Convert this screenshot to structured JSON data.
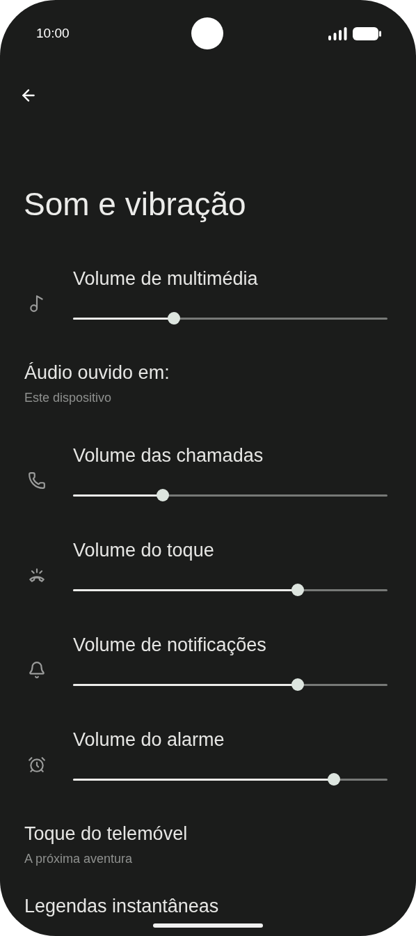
{
  "status_bar": {
    "time": "10:00"
  },
  "title": "Som e vibração",
  "items": [
    {
      "kind": "slider",
      "label": "Volume de multimédia",
      "level": 0.32
    },
    {
      "kind": "text",
      "label": "Áudio ouvido em:",
      "subtitle": "Este dispositivo"
    },
    {
      "kind": "slider",
      "label": "Volume das chamadas",
      "level": 0.285
    },
    {
      "kind": "slider",
      "label": "Volume do toque",
      "level": 0.715
    },
    {
      "kind": "slider",
      "label": "Volume de notificações",
      "level": 0.715
    },
    {
      "kind": "slider",
      "label": "Volume do alarme",
      "level": 0.83
    },
    {
      "kind": "text",
      "label": "Toque do telemóvel",
      "subtitle": "A próxima aventura"
    },
    {
      "kind": "text",
      "label": "Legendas instantâneas"
    }
  ]
}
